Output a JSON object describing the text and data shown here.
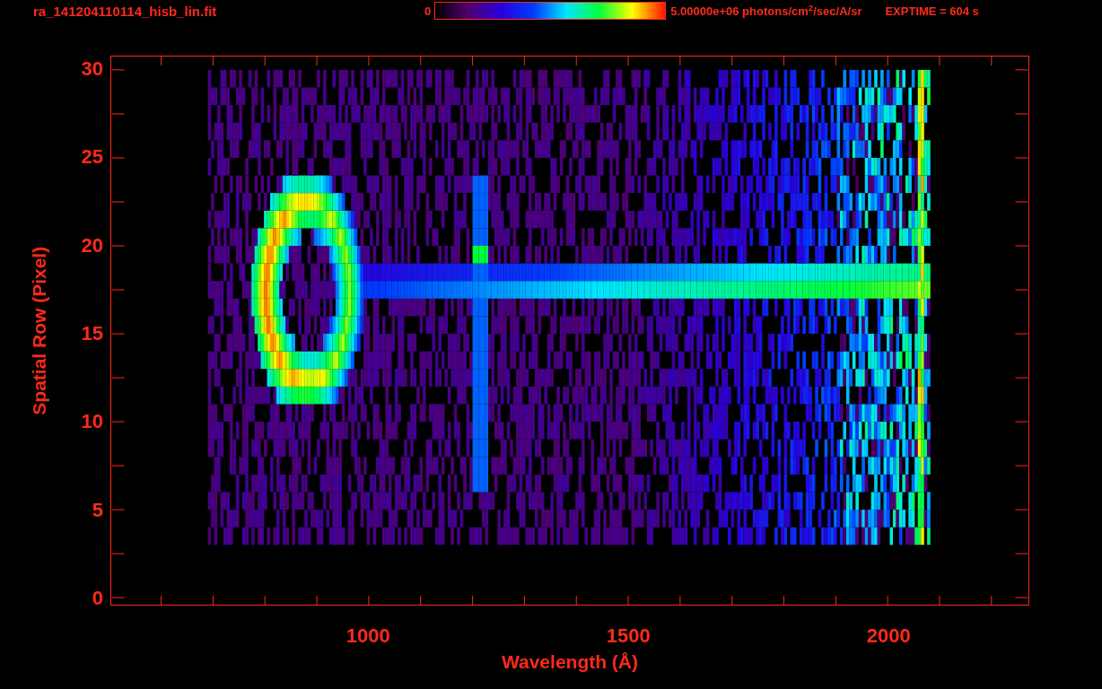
{
  "header": {
    "filename": "ra_141204110114_hisb_lin.fit",
    "colorbar_min": "0",
    "colorbar_max": "5.00000e+06 photons/cm$^{2}$/sec/A/sr",
    "exptime": "EXPTIME = 604 s"
  },
  "plot": {
    "ylabel": "Spatial Row (Pixel)",
    "xlabel": "Wavelength (Å)",
    "yticks": [
      "30",
      "25",
      "20",
      "15",
      "10",
      "5",
      "0"
    ],
    "xticks": [
      "1000",
      "1500",
      "2000"
    ]
  }
}
